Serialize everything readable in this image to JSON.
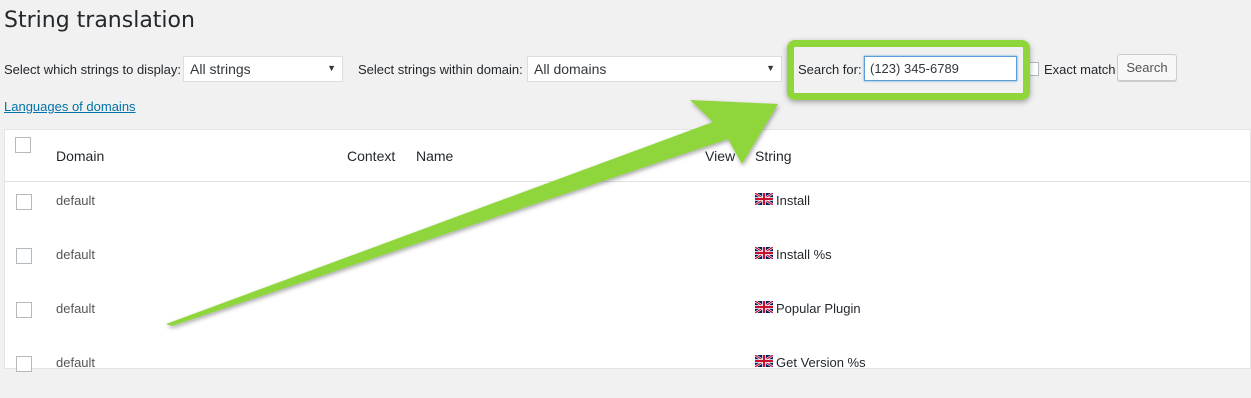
{
  "page": {
    "title": "String translation"
  },
  "filters": {
    "display_label": "Select which strings to display:",
    "display_value": "All strings",
    "domain_label": "Select strings within domain:",
    "domain_value": "All domains",
    "search_label": "Search for:",
    "search_value": "(123) 345-6789",
    "exact_match_label": "Exact match",
    "search_button": "Search"
  },
  "links": {
    "languages_of_domains": "Languages of domains"
  },
  "table": {
    "columns": {
      "domain": "Domain",
      "context": "Context",
      "name": "Name",
      "view": "View",
      "string": "String"
    },
    "rows": [
      {
        "domain": "default",
        "string": "Install"
      },
      {
        "domain": "default",
        "string": "Install %s"
      },
      {
        "domain": "default",
        "string": "Popular Plugin"
      },
      {
        "domain": "default",
        "string": "Get Version %s"
      }
    ]
  },
  "colors": {
    "annotation": "#8ed63a",
    "link": "#0073aa"
  },
  "icons": {
    "row_flag": "uk-flag-icon"
  }
}
